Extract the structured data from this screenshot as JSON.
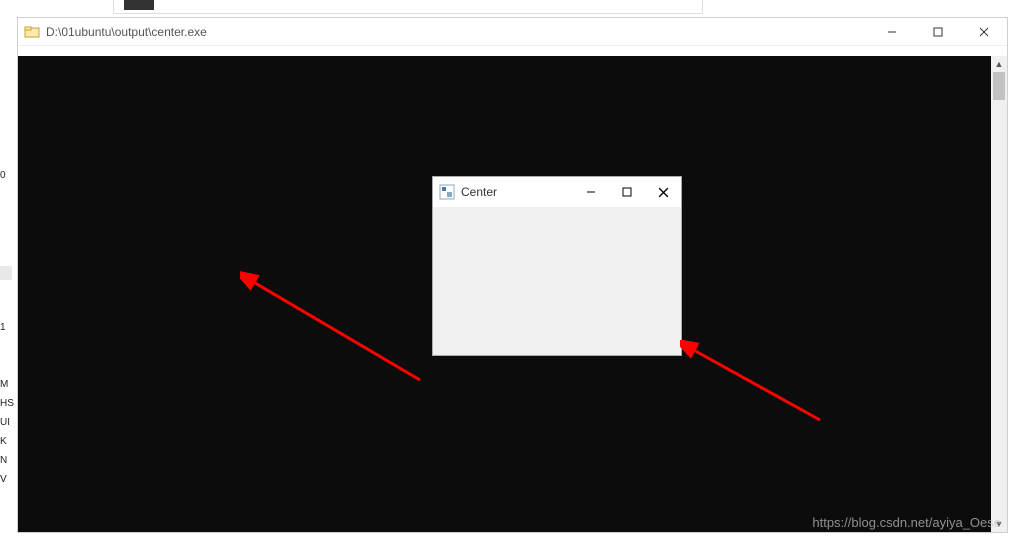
{
  "outer_window": {
    "title": "D:\\01ubuntu\\output\\center.exe"
  },
  "inner_window": {
    "title": "Center"
  },
  "side_fragments": {
    "t0": "0",
    "t1": "1",
    "t2": "M",
    "t3": "HS",
    "t4": "UI",
    "t5": "K",
    "t6": "N",
    "t7": "V"
  },
  "watermark": "https://blog.csdn.net/ayiya_Oese"
}
